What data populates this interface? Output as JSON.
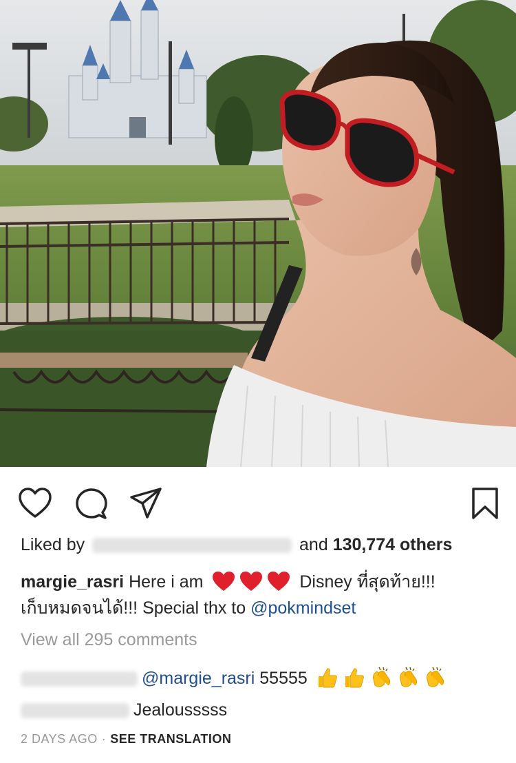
{
  "post": {
    "image_alt": "Woman with red sunglasses in front of castle",
    "liked_by_prefix": "Liked by",
    "liked_by_and": "and",
    "likes_count": "130,774 others",
    "caption_user": "margie_rasri",
    "caption_text_1": "Here i am",
    "caption_text_2": "Disney ที่สุดท้าย!!!",
    "caption_line2_text": "เก็บหมดจนได้!!! Special thx to",
    "caption_mention": "@pokmindset",
    "view_comments": "View all 295 comments",
    "comments": [
      {
        "mention": "@margie_rasri",
        "text": "55555"
      },
      {
        "text": "Jealousssss"
      }
    ],
    "time_ago": "2 DAYS AGO",
    "separator": "·",
    "see_translation": "SEE TRANSLATION"
  },
  "icons": {
    "like": "heart-icon",
    "comment": "comment-icon",
    "share": "send-icon",
    "save": "bookmark-icon"
  },
  "colors": {
    "text": "#262626",
    "muted": "#999999",
    "link": "#1f4f91",
    "heart_red": "#e0202c"
  }
}
